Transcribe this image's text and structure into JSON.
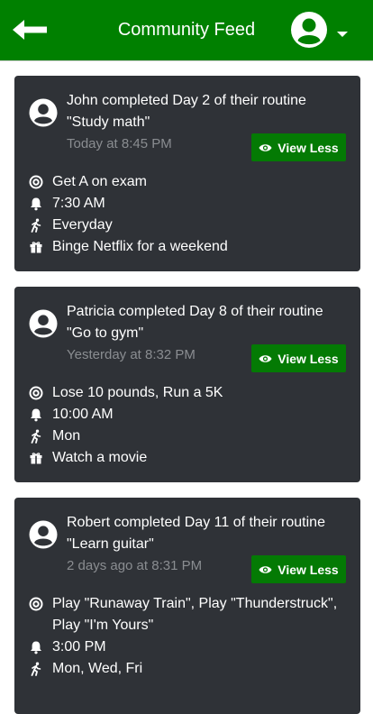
{
  "header": {
    "title": "Community Feed",
    "back_icon": "arrow-left-icon",
    "avatar_icon": "user-circle-icon",
    "dropdown_icon": "caret-down-icon",
    "bg_color": "#008000"
  },
  "posts": [
    {
      "headline": "John completed Day 2 of their routine \"Study math\"",
      "time": "Today at 8:45 PM",
      "button": "View Less",
      "goal": "Get A on exam",
      "reminder": "7:30 AM",
      "frequency": "Everyday",
      "reward": "Binge Netflix for a weekend"
    },
    {
      "headline": "Patricia completed Day 8 of their routine \"Go to gym\"",
      "time": "Yesterday at 8:32 PM",
      "button": "View Less",
      "goal": "Lose 10 pounds, Run a 5K",
      "reminder": "10:00 AM",
      "frequency": "Mon",
      "reward": "Watch a movie"
    },
    {
      "headline": "Robert completed Day 11 of their routine \"Learn guitar\"",
      "time": "2 days ago at 8:31 PM",
      "button": "View Less",
      "goal": "Play \"Runaway Train\", Play \"Thunderstruck\", Play \"I'm Yours\"",
      "reminder": "3:00 PM",
      "frequency": "Mon, Wed, Fri",
      "reward": ""
    }
  ]
}
